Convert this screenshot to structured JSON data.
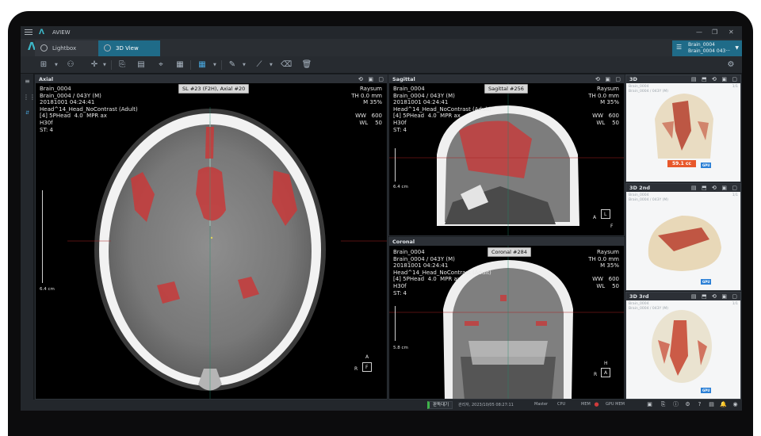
{
  "app": {
    "title": "AVIEW"
  },
  "window": {
    "minimize": "—",
    "restore": "❐",
    "close": "✕"
  },
  "tabs": [
    {
      "label": "Lightbox"
    },
    {
      "label": "3D View"
    }
  ],
  "user": {
    "line1": "Brain_0004",
    "line2": "Brain_0004 043···"
  },
  "viewports": {
    "axial": {
      "name": "Axial",
      "tag": "SL #23 (F2H),  Axial #20",
      "info_left": "Brain_0004\nBrain_0004 / 043Y (M)\n20181001 04:24:41\nHead^14_Head_NoContrast (Adult)\n[4] 5PHead  4.0  MPR ax\nH30f\nST: 4",
      "info_right": "Raysum\nTH 0.0 mm\nM 35%\n\nWW   600\nWL    50",
      "ruler": "6.4 cm",
      "orient_top": "A",
      "orient_left": "R",
      "orient_face": "F"
    },
    "sagittal": {
      "name": "Sagittal",
      "tag": "Sagittal #256",
      "info_left": "Brain_0004\nBrain_0004 / 043Y (M)\n20181001 04:24:41\nHead^14_Head_NoContrast (Adult)\n[4] 5PHead  4.0  MPR ax\nH30f\nST: 4",
      "info_right": "Raysum\nTH 0.0 mm\nM 35%\n\nWW   600\nWL    50",
      "ruler": "6.4 cm",
      "orient_left": "A",
      "orient_face": "L",
      "orient_bottom": "F"
    },
    "coronal": {
      "name": "Coronal",
      "tag": "Coronal #284",
      "info_left": "Brain_0004\nBrain_0004 / 043Y (M)\n20181001 04:24:41\nHead^14_Head_NoContrast (Adult)\n[4] 5PHead  4.0  MPR ax\nH30f\nST: 4",
      "info_right": "Raysum\nTH 0.0 mm\nM 35%\n\nWW   600\nWL    50",
      "ruler": "5.8 cm",
      "orient_top": "H",
      "orient_left": "R",
      "orient_face": "A"
    }
  },
  "panels3d": [
    {
      "name": "3D",
      "info": "Brain_0004\nBrain_0004 / 043Y (M)",
      "num": "1/1",
      "volume": "59.1 cc",
      "gpu": "GPU"
    },
    {
      "name": "3D 2nd",
      "info": "Brain_0004\nBrain_0004 / 043Y (M)",
      "num": "1/1",
      "gpu": "GPU"
    },
    {
      "name": "3D 3rd",
      "info": "Brain_0004\nBrain_0004 / 043Y (M)",
      "num": "1/1",
      "gpu": "GPU"
    }
  ],
  "status": {
    "job": "판독대기",
    "user_time": "관리자, 2023/10/05 08:27:11",
    "master": "Master",
    "cpu": "CPU",
    "mem": "MEM",
    "gpu_mem": "GPU MEM"
  },
  "colors": {
    "accent": "#1f6b88",
    "highlight": "#cf3b3b",
    "badge": "#e8582b"
  },
  "icons": [
    "menu-icon",
    "app-logo-icon",
    "settings-icon",
    "grid-layout-icon",
    "pen-icon",
    "eraser-icon",
    "delete-icon"
  ]
}
